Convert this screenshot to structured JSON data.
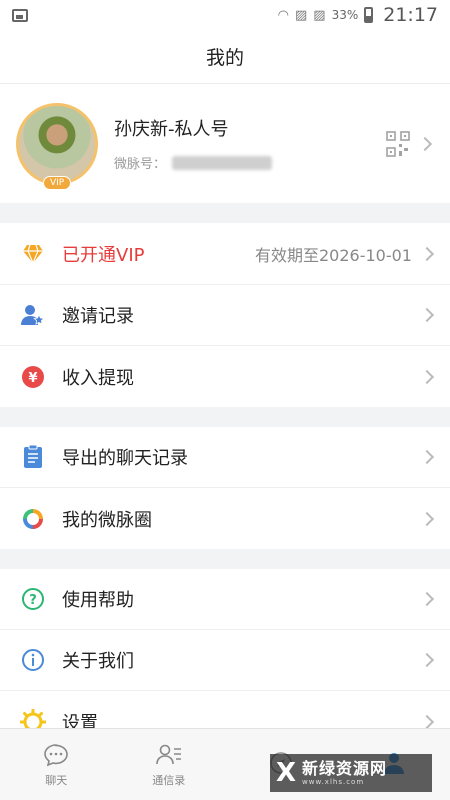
{
  "status_bar": {
    "battery": "33%",
    "time": "21:17"
  },
  "header": {
    "title": "我的"
  },
  "profile": {
    "name": "孙庆新-私人号",
    "id_label": "微脉号：",
    "vip_badge": "VIP"
  },
  "sections": [
    [
      {
        "id": "vip",
        "label": "已开通VIP",
        "extra": "有效期至2026-10-01",
        "icon": "diamond-icon",
        "color": "#e83c3c"
      }
    ],
    [
      {
        "id": "invite",
        "label": "邀请记录",
        "icon": "person-star-icon"
      },
      {
        "id": "income",
        "label": "收入提现",
        "icon": "yen-icon"
      }
    ],
    [
      {
        "id": "export",
        "label": "导出的聊天记录",
        "icon": "clipboard-icon"
      },
      {
        "id": "circle",
        "label": "我的微脉圈",
        "icon": "ring-icon"
      }
    ],
    [
      {
        "id": "help",
        "label": "使用帮助",
        "icon": "question-icon"
      },
      {
        "id": "about",
        "label": "关于我们",
        "icon": "info-icon"
      },
      {
        "id": "settings",
        "label": "设置",
        "icon": "gear-icon"
      }
    ]
  ],
  "tabbar": {
    "items": [
      {
        "label": "聊天",
        "icon": "chat-icon"
      },
      {
        "label": "通信录",
        "icon": "contacts-icon"
      },
      {
        "label": "",
        "icon": "discover-icon"
      },
      {
        "label": "",
        "icon": "me-icon"
      }
    ]
  },
  "watermark": {
    "logo": "X",
    "name": "新绿资源网",
    "url": "www.xlhs.com"
  }
}
